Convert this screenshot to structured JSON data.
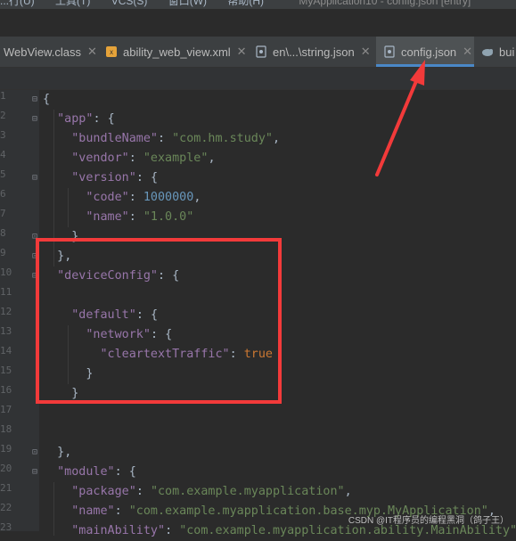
{
  "menubar": {
    "items": [
      "...行(U)",
      "工具(T)",
      "VCS(S)",
      "窗口(W)",
      "帮助(H)"
    ],
    "window_title": "MyApplication10 - config.json [entry]"
  },
  "tabs": [
    {
      "label": "WebView.class",
      "icon": "class-file-icon",
      "active": false
    },
    {
      "label": "ability_web_view.xml",
      "icon": "xml-file-icon",
      "active": false
    },
    {
      "label": "en\\...\\string.json",
      "icon": "json-file-icon",
      "active": false
    },
    {
      "label": "config.json",
      "icon": "json-file-icon",
      "active": true
    },
    {
      "label": "bui",
      "icon": "gradle-icon",
      "active": false
    }
  ],
  "code_lines": [
    "{",
    "  \"app\": {",
    "    \"bundleName\": \"com.hm.study\",",
    "    \"vendor\": \"example\",",
    "    \"version\": {",
    "      \"code\": 1000000,",
    "      \"name\": \"1.0.0\"",
    "    }",
    "  },",
    "  \"deviceConfig\": {",
    "",
    "    \"default\": {",
    "      \"network\": {",
    "        \"cleartextTraffic\": true",
    "      }",
    "    }",
    "",
    "",
    "  },",
    "  \"module\": {",
    "    \"package\": \"com.example.myapplication\",",
    "    \"name\": \"com.example.myapplication.base.myp.MyApplication\",",
    "    \"mainAbility\": \"com.example.myapplication.ability.MainAbility\","
  ],
  "gutter_numbers": [
    "1",
    "2",
    "3",
    "4",
    "5",
    "6",
    "7",
    "8",
    "9",
    "10",
    "11",
    "12",
    "13",
    "14",
    "15",
    "16",
    "17",
    "18",
    "19",
    "20",
    "21",
    "22",
    "23"
  ],
  "watermark": "CSDN @IT程序员的编程黑洞（鸽子王）",
  "colors": {
    "background": "#2b2b2b",
    "key": "#9876aa",
    "string": "#6a8759",
    "number": "#6897bb",
    "keyword": "#cc7832",
    "annotation": "#f23a3a",
    "active_tab_underline": "#4a88c7"
  }
}
